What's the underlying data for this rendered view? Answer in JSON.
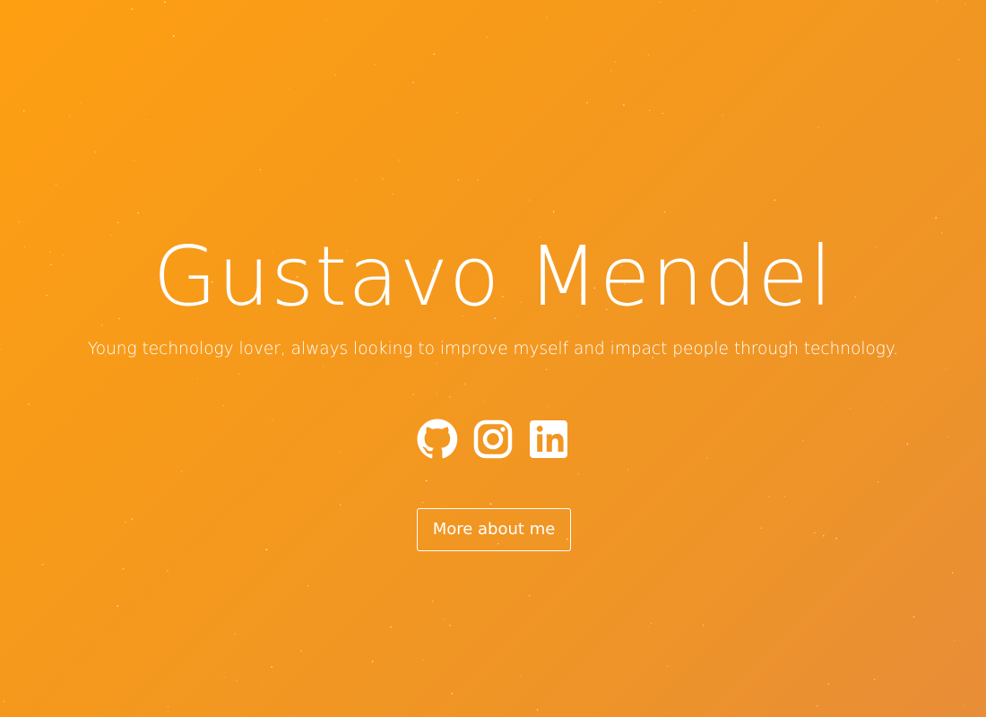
{
  "hero": {
    "name": "Gustavo Mendel",
    "tagline": "Young technology lover, always looking to improve myself and impact people through technology.",
    "background_colors": [
      "#fe9f12",
      "#e88d38"
    ],
    "text_color": "#ffffff"
  },
  "socials": [
    {
      "name": "GitHub",
      "icon": "github-icon"
    },
    {
      "name": "Instagram",
      "icon": "instagram-icon"
    },
    {
      "name": "LinkedIn",
      "icon": "linkedin-icon"
    }
  ],
  "cta": {
    "label": "More about me"
  }
}
